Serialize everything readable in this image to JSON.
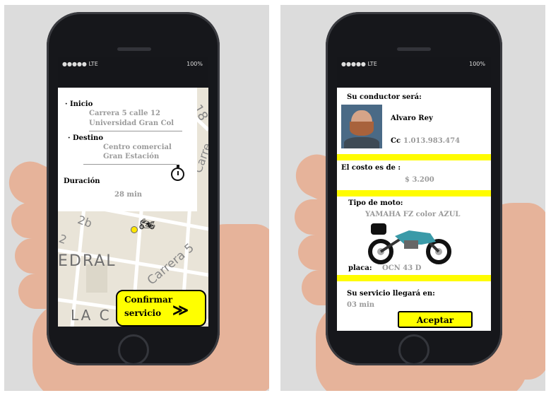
{
  "left_screen": {
    "status": {
      "signal": "●●●●● LTE",
      "battery": "100%"
    },
    "inicio_label": "· Inicio",
    "inicio_line1": "Carrera 5 calle 12",
    "inicio_line2": "Universidad Gran Col",
    "destino_label": "· Destino",
    "destino_line1": "Centro comercial",
    "destino_line2": "Gran Estación",
    "duracion_label": "Duración",
    "duracion_value": "28 min",
    "map_labels": {
      "edral": "EDRAL",
      "carrera": "Carrera 5",
      "lac": "LA C",
      "carr_top": "Carre",
      "num_18": "18",
      "num_2b": "2b",
      "num_2": "2"
    },
    "confirm_line1": "Confirmar",
    "confirm_line2": "servicio",
    "confirm_arrows": "≫"
  },
  "right_screen": {
    "status": {
      "signal": "●●●●● LTE",
      "battery": "100%"
    },
    "driver_heading": "Su conductor será:",
    "driver_name": "Alvaro Rey",
    "cc_label": "Cc",
    "cc_value": "1.013.983.474",
    "cost_label": "El costo es de :",
    "cost_value": "$ 3.200",
    "moto_label": "Tipo de moto:",
    "moto_value": "YAMAHA FZ  color AZUL",
    "placa_label": "placa:",
    "placa_value": "OCN 43 D",
    "arrival_label": "Su servicio llegará en:",
    "arrival_value": "03 min",
    "accept_label": "Aceptar"
  },
  "colors": {
    "accent_yellow": "#fffc00",
    "button_yellow": "#ffff00",
    "map_bg": "#e9e4d8"
  }
}
